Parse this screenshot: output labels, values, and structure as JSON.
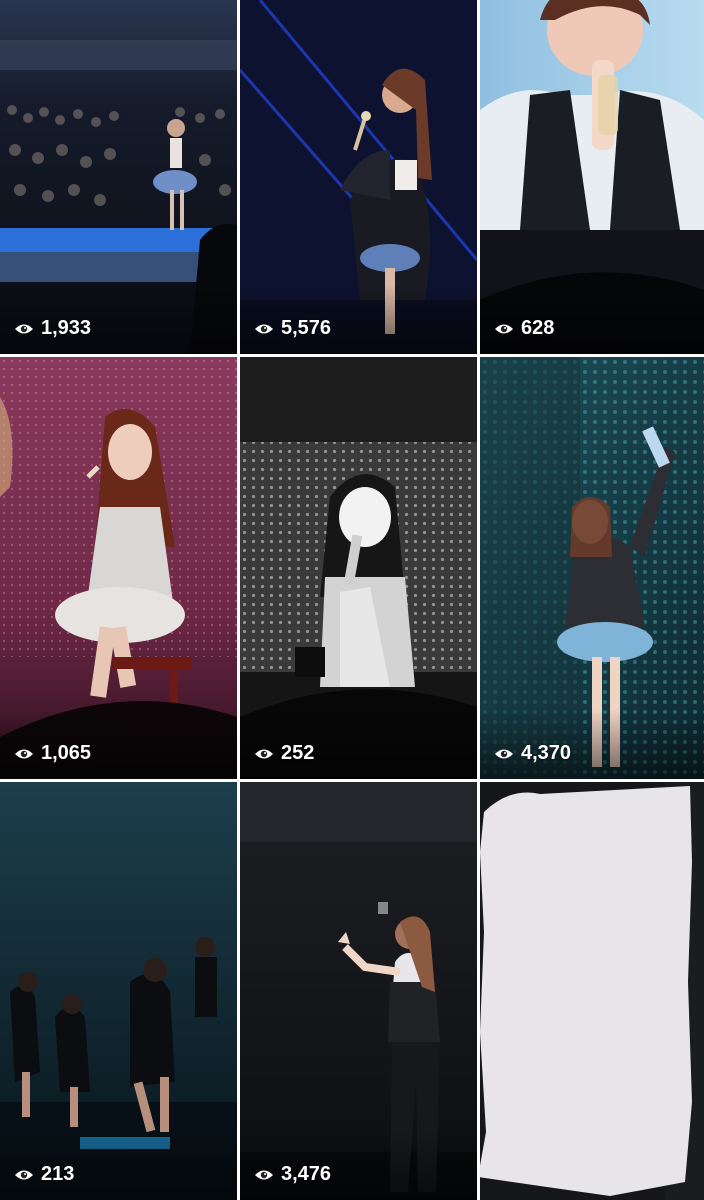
{
  "posts": [
    {
      "views": "1,933",
      "icon": "eye-icon",
      "scene": "stage-crowd-blue"
    },
    {
      "views": "5,576",
      "icon": "eye-icon",
      "scene": "singer-navy-lights"
    },
    {
      "views": "628",
      "icon": "eye-icon",
      "scene": "closeup-screen-blue"
    },
    {
      "views": "1,065",
      "icon": "eye-icon",
      "scene": "seated-magenta"
    },
    {
      "views": "252",
      "icon": "eye-icon",
      "scene": "monochrome-screen"
    },
    {
      "views": "4,370",
      "icon": "eye-icon",
      "scene": "teal-led-wall"
    },
    {
      "views": "213",
      "icon": "eye-icon",
      "scene": "dancers-teal"
    },
    {
      "views": "3,476",
      "icon": "eye-icon",
      "scene": "dark-stage-gesture"
    },
    {
      "views": "",
      "icon": "",
      "scene": "hidden-redacted"
    }
  ],
  "colors": {
    "background": "#ffffff",
    "text": "#ffffff",
    "redaction": "#e7e5e8"
  }
}
